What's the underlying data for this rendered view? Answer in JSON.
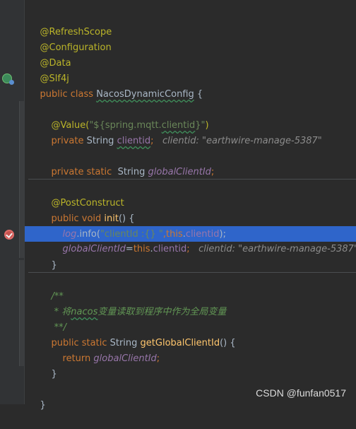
{
  "code": {
    "anno_refresh": "@RefreshScope",
    "anno_config": "@Configuration",
    "anno_data": "@Data",
    "anno_slf4j": "@Slf4j",
    "class_kw": "public class ",
    "class_name": "NacosDynamicConfig",
    "class_open": " {",
    "value_anno_prefix": "@Value(",
    "value_str_prefix": "\"${spring.mqtt.",
    "value_str_wavy": "clientid",
    "value_str_suffix": "}\"",
    "value_anno_close": ")",
    "field1_kw": "private ",
    "field1_type": "String ",
    "field1_name": "clientid",
    "field1_semi": ";",
    "field1_hint": "clientid: \"earthwire-manage-5387\"",
    "field2_kw": "private static  ",
    "field2_type": "String ",
    "field2_name": "globalClientId",
    "field2_semi": ";",
    "postconstruct": "@PostConstruct",
    "init_kw": "public void ",
    "init_name": "init",
    "init_rest": "() {",
    "log_obj": "log",
    "log_dot": ".",
    "log_method": "info",
    "log_open": "(",
    "log_str": "\"clientId :{} \"",
    "log_comma": ",",
    "log_this": "this",
    "log_dot2": ".",
    "log_field": "clientid",
    "log_close": ");",
    "assign_target": "globalClientId",
    "assign_eq": "=",
    "assign_this": "this",
    "assign_dot": ".",
    "assign_field": "clientid",
    "assign_semi": ";",
    "assign_hint": "clientid: \"earthwire-manage-5387\"",
    "close_brace": "}",
    "doc_open": "/**",
    "doc_line_prefix": " * 将",
    "doc_line_wavy": "nacos",
    "doc_line_suffix": "变量读取到程序中作为全局变量",
    "doc_close": " **/",
    "getter_kw": "public static ",
    "getter_type": "String ",
    "getter_name": "getGlobalClientId",
    "getter_rest": "() {",
    "return_kw": "return ",
    "return_field": "globalClientId",
    "return_semi": ";",
    "method_close": "}",
    "class_close": "}"
  },
  "gutter": {
    "spring_icon": "spring-bean-icon",
    "breakpoint_icon": "breakpoint-check-icon"
  },
  "watermark": "CSDN @funfan0517",
  "colors": {
    "background": "#2b2b2b",
    "highlight": "#2f65ca",
    "annotation": "#bbb529",
    "keyword": "#cc7832",
    "string": "#6a8759",
    "field": "#9876aa",
    "method": "#ffc66d",
    "comment": "#629755"
  }
}
